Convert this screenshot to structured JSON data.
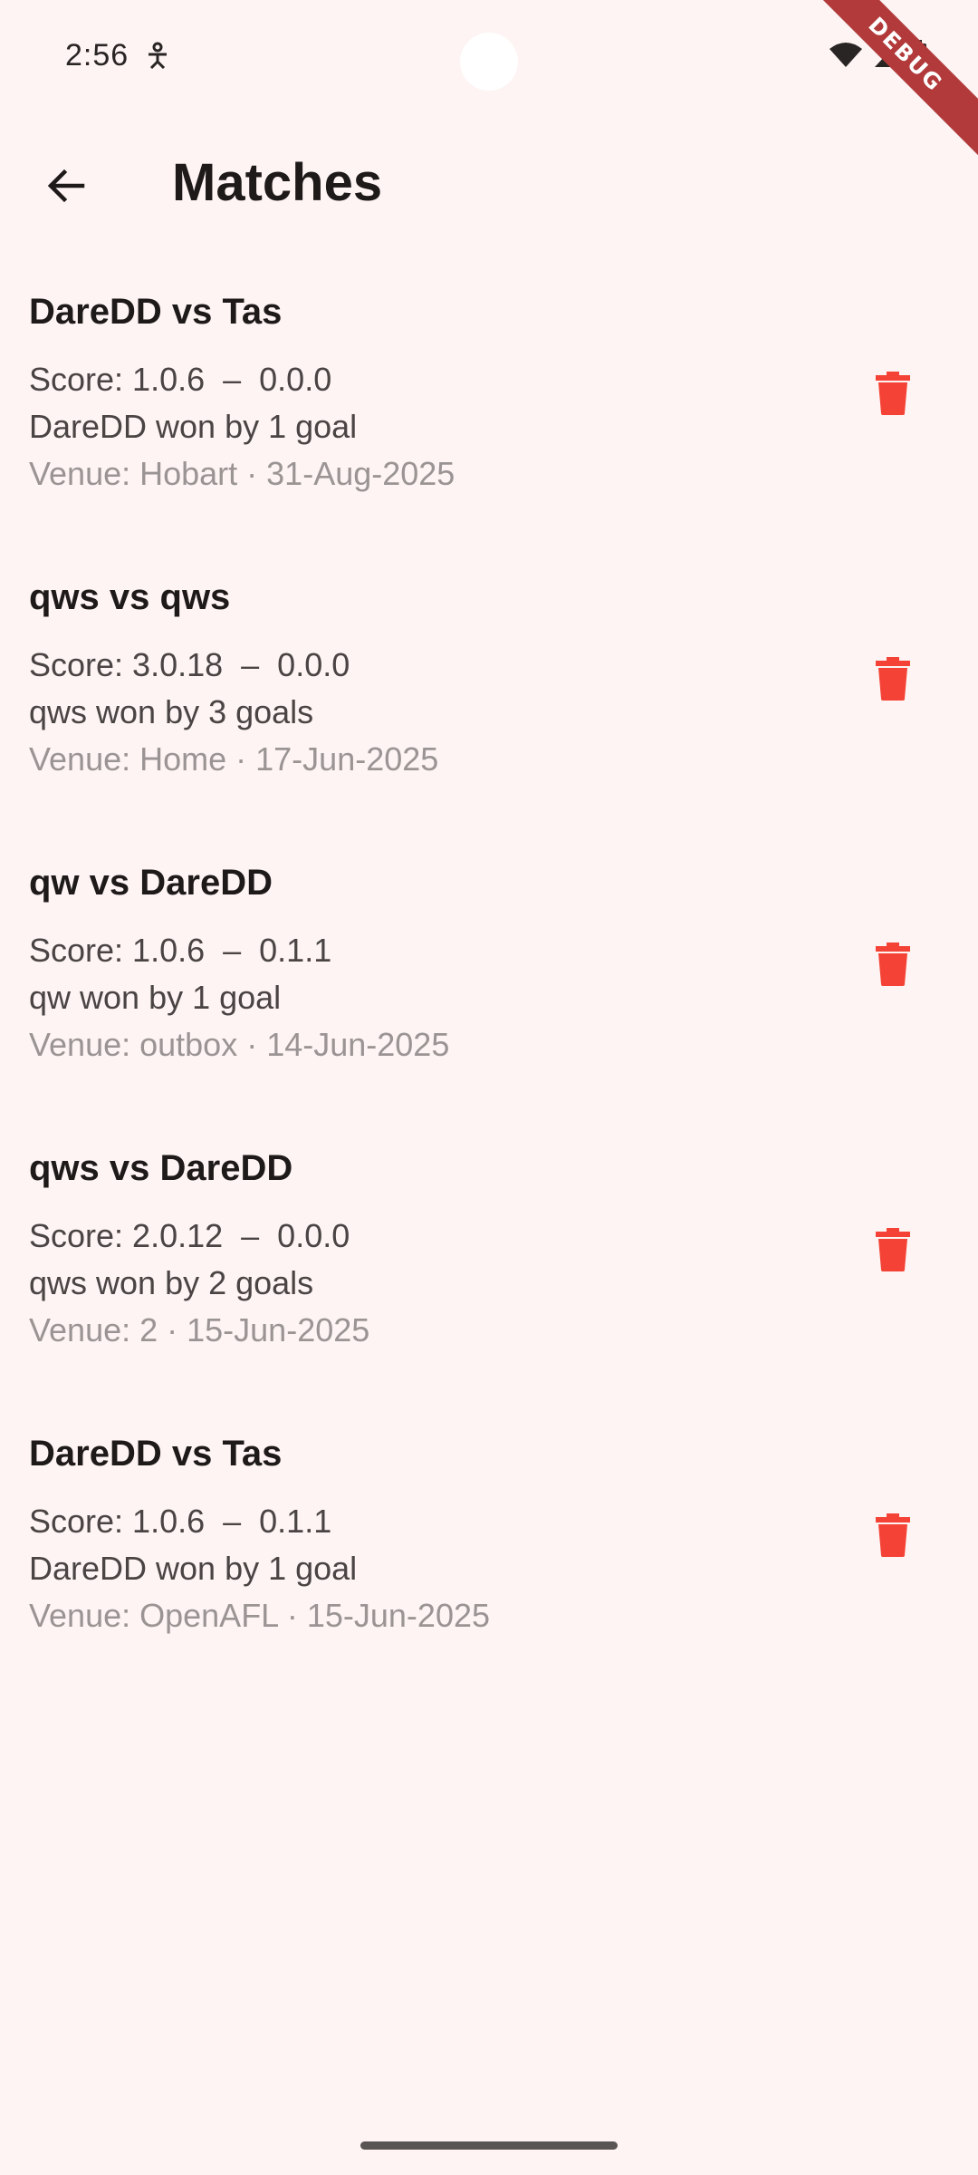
{
  "status_bar": {
    "time": "2:56",
    "debug_label": "DEBUG"
  },
  "header": {
    "title": "Matches"
  },
  "matches": [
    {
      "title": "DareDD vs Tas",
      "score": "Score: 1.0.6  –  0.0.0",
      "result": "DareDD won by 1 goal",
      "venue": "Venue: Hobart · 31-Aug-2025"
    },
    {
      "title": "qws vs qws",
      "score": "Score: 3.0.18  –  0.0.0",
      "result": "qws won by 3 goals",
      "venue": "Venue: Home · 17-Jun-2025"
    },
    {
      "title": "qw vs DareDD",
      "score": "Score: 1.0.6  –  0.1.1",
      "result": "qw won by 1 goal",
      "venue": "Venue: outbox · 14-Jun-2025"
    },
    {
      "title": "qws vs DareDD",
      "score": "Score: 2.0.12  –  0.0.0",
      "result": "qws won by 2 goals",
      "venue": "Venue: 2 · 15-Jun-2025"
    },
    {
      "title": "DareDD vs Tas",
      "score": "Score: 1.0.6  –  0.1.1",
      "result": "DareDD won by 1 goal",
      "venue": "Venue: OpenAFL · 15-Jun-2025"
    }
  ],
  "icons": {
    "back": "arrow-back-icon",
    "delete": "trash-icon"
  },
  "colors": {
    "background": "#fdf4f3",
    "delete_icon": "#f44336",
    "debug_banner": "#b23a3a"
  }
}
